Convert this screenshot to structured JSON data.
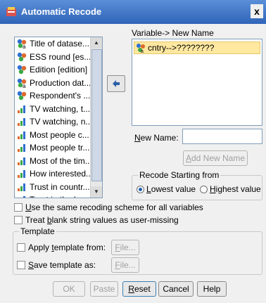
{
  "window": {
    "title": "Automatic Recode",
    "close_label": "x"
  },
  "source_list": {
    "items": [
      {
        "icon": "nominal-string-icon",
        "label": "Title of datase..."
      },
      {
        "icon": "nominal-icon",
        "label": "ESS round [es..."
      },
      {
        "icon": "nominal-icon",
        "label": "Edition [edition]"
      },
      {
        "icon": "nominal-string-icon",
        "label": "Production dat..."
      },
      {
        "icon": "nominal-icon",
        "label": "Respondent's ..."
      },
      {
        "icon": "ordinal-icon",
        "label": "TV watching, t..."
      },
      {
        "icon": "ordinal-icon",
        "label": "TV watching, n..."
      },
      {
        "icon": "ordinal-icon",
        "label": "Most people c..."
      },
      {
        "icon": "ordinal-icon",
        "label": "Most people tr..."
      },
      {
        "icon": "ordinal-icon",
        "label": "Most of the tim..."
      },
      {
        "icon": "ordinal-icon",
        "label": "How interested..."
      },
      {
        "icon": "ordinal-icon",
        "label": "Trust in countr..."
      },
      {
        "icon": "ordinal-icon",
        "label": "Trust in the le..."
      }
    ]
  },
  "target": {
    "heading": "Variable-> New Name",
    "selected": "cntry-->????????"
  },
  "new_name": {
    "label_underlined": "N",
    "label_rest": "ew Name:",
    "value": ""
  },
  "add_new_name": {
    "prefix": "",
    "underlined": "A",
    "rest": "dd New Name"
  },
  "recode_group": {
    "legend": "Recode Starting from",
    "lowest": {
      "underlined": "L",
      "rest": "owest value",
      "checked": true
    },
    "highest": {
      "underlined": "H",
      "rest": "ighest value",
      "checked": false
    }
  },
  "options": {
    "same_scheme": {
      "underlined": "U",
      "rest": "se the same recoding scheme for all variables",
      "checked": false
    },
    "blank_string": {
      "prefix": "Treat ",
      "underlined": "b",
      "rest": "lank string values as user-missing",
      "checked": false
    }
  },
  "template_group": {
    "legend": "Template",
    "apply": {
      "prefix": "Apply ",
      "underlined": "t",
      "rest": "emplate from:",
      "checked": false
    },
    "save": {
      "prefix": "",
      "underlined": "S",
      "rest": "ave template as:",
      "checked": false
    },
    "file_label_underlined": "F",
    "file_label_rest": "ile..."
  },
  "buttons": {
    "ok": "OK",
    "paste": "Paste",
    "reset_underlined": "R",
    "reset_rest": "eset",
    "cancel": "Cancel",
    "help": "Help"
  },
  "colors": {
    "title_bar": "#2f64b8",
    "selection": "#ffe8a0"
  }
}
